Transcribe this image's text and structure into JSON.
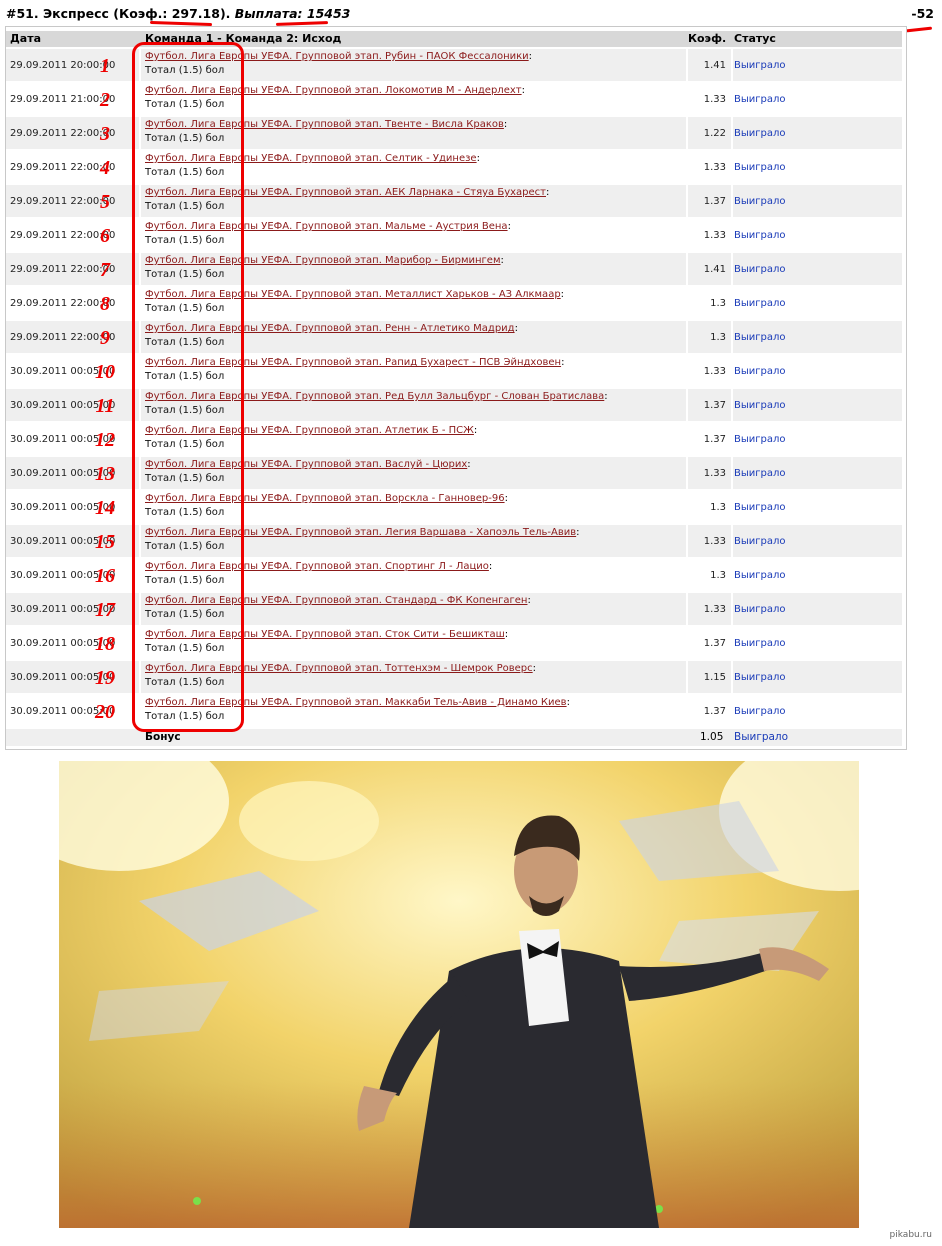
{
  "header": {
    "prefix": "#51. Экспресс (Коэф.: ",
    "coef": "297.18",
    "mid": "). ",
    "payout_label": "Выплата: ",
    "payout_value": "15453",
    "right_value": "-52"
  },
  "columns": {
    "date": "Дата",
    "event": "Команда 1 - Команда 2: Исход",
    "coef": "Коэф.",
    "status": "Статус"
  },
  "rows": [
    {
      "n": "1",
      "date": "29.09.2011 20:00:00",
      "event": "Футбол. Лига Европы УЕФА. Групповой этап. Рубин - ПАОК Фессалоники",
      "bet": "Тотал (1.5) бол",
      "coef": "1.41",
      "status": "Выиграло"
    },
    {
      "n": "2",
      "date": "29.09.2011 21:00:00",
      "event": "Футбол. Лига Европы УЕФА. Групповой этап. Локомотив М - Андерлехт",
      "bet": "Тотал (1.5) бол",
      "coef": "1.33",
      "status": "Выиграло"
    },
    {
      "n": "3",
      "date": "29.09.2011 22:00:00",
      "event": "Футбол. Лига Европы УЕФА. Групповой этап. Твенте - Висла Краков",
      "bet": "Тотал (1.5) бол",
      "coef": "1.22",
      "status": "Выиграло"
    },
    {
      "n": "4",
      "date": "29.09.2011 22:00:00",
      "event": "Футбол. Лига Европы УЕФА. Групповой этап. Селтик - Удинезе",
      "bet": "Тотал (1.5) бол",
      "coef": "1.33",
      "status": "Выиграло"
    },
    {
      "n": "5",
      "date": "29.09.2011 22:00:00",
      "event": "Футбол. Лига Европы УЕФА. Групповой этап. АЕК Ларнака - Стяуа Бухарест",
      "bet": "Тотал (1.5) бол",
      "coef": "1.37",
      "status": "Выиграло"
    },
    {
      "n": "6",
      "date": "29.09.2011 22:00:00",
      "event": "Футбол. Лига Европы УЕФА. Групповой этап. Мальме - Аустрия Вена",
      "bet": "Тотал (1.5) бол",
      "coef": "1.33",
      "status": "Выиграло"
    },
    {
      "n": "7",
      "date": "29.09.2011 22:00:00",
      "event": "Футбол. Лига Европы УЕФА. Групповой этап. Марибор - Бирмингем",
      "bet": "Тотал (1.5) бол",
      "coef": "1.41",
      "status": "Выиграло"
    },
    {
      "n": "8",
      "date": "29.09.2011 22:00:00",
      "event": "Футбол. Лига Европы УЕФА. Групповой этап. Металлист Харьков - АЗ Алкмаар",
      "bet": "Тотал (1.5) бол",
      "coef": "1.3",
      "status": "Выиграло"
    },
    {
      "n": "9",
      "date": "29.09.2011 22:00:00",
      "event": "Футбол. Лига Европы УЕФА. Групповой этап. Ренн - Атлетико Мадрид",
      "bet": "Тотал (1.5) бол",
      "coef": "1.3",
      "status": "Выиграло"
    },
    {
      "n": "10",
      "date": "30.09.2011 00:05:00",
      "event": "Футбол. Лига Европы УЕФА. Групповой этап. Рапид Бухарест - ПСВ Эйндховен",
      "bet": "Тотал (1.5) бол",
      "coef": "1.33",
      "status": "Выиграло"
    },
    {
      "n": "11",
      "date": "30.09.2011 00:05:00",
      "event": "Футбол. Лига Европы УЕФА. Групповой этап. Ред Булл Зальцбург - Слован Братислава",
      "bet": "Тотал (1.5) бол",
      "coef": "1.37",
      "status": "Выиграло"
    },
    {
      "n": "12",
      "date": "30.09.2011 00:05:00",
      "event": "Футбол. Лига Европы УЕФА. Групповой этап. Атлетик Б - ПСЖ",
      "bet": "Тотал (1.5) бол",
      "coef": "1.37",
      "status": "Выиграло"
    },
    {
      "n": "13",
      "date": "30.09.2011 00:05:00",
      "event": "Футбол. Лига Европы УЕФА. Групповой этап. Васлуй - Цюрих",
      "bet": "Тотал (1.5) бол",
      "coef": "1.33",
      "status": "Выиграло"
    },
    {
      "n": "14",
      "date": "30.09.2011 00:05:00",
      "event": "Футбол. Лига Европы УЕФА. Групповой этап. Ворскла - Ганновер-96",
      "bet": "Тотал (1.5) бол",
      "coef": "1.3",
      "status": "Выиграло"
    },
    {
      "n": "15",
      "date": "30.09.2011 00:05:00",
      "event": "Футбол. Лига Европы УЕФА. Групповой этап. Легия Варшава - Хапоэль Тель-Авив",
      "bet": "Тотал (1.5) бол",
      "coef": "1.33",
      "status": "Выиграло"
    },
    {
      "n": "16",
      "date": "30.09.2011 00:05:00",
      "event": "Футбол. Лига Европы УЕФА. Групповой этап. Спортинг Л - Лацио",
      "bet": "Тотал (1.5) бол",
      "coef": "1.3",
      "status": "Выиграло"
    },
    {
      "n": "17",
      "date": "30.09.2011 00:05:00",
      "event": "Футбол. Лига Европы УЕФА. Групповой этап. Стандард - ФК Копенгаген",
      "bet": "Тотал (1.5) бол",
      "coef": "1.33",
      "status": "Выиграло"
    },
    {
      "n": "18",
      "date": "30.09.2011 00:05:00",
      "event": "Футбол. Лига Европы УЕФА. Групповой этап. Сток Сити - Бешикташ",
      "bet": "Тотал (1.5) бол",
      "coef": "1.37",
      "status": "Выиграло"
    },
    {
      "n": "19",
      "date": "30.09.2011 00:05:00",
      "event": "Футбол. Лига Европы УЕФА. Групповой этап. Тоттенхэм - Шемрок Роверс",
      "bet": "Тотал (1.5) бол",
      "coef": "1.15",
      "status": "Выиграло"
    },
    {
      "n": "20",
      "date": "30.09.2011 00:05:00",
      "event": "Футбол. Лига Европы УЕФА. Групповой этап. Маккаби Тель-Авив - Динамо Киев",
      "bet": "Тотал (1.5) бол",
      "coef": "1.37",
      "status": "Выиграло"
    }
  ],
  "bonus": {
    "label": "Бонус",
    "coef": "1.05",
    "status": "Выиграло"
  },
  "watermark": "pikabu.ru",
  "colors": {
    "annotation": "#e00000",
    "link": "#8b1a1a",
    "status": "#1a3bb8",
    "header_bg": "#d8d8d8",
    "alt_row": "#efefef"
  }
}
